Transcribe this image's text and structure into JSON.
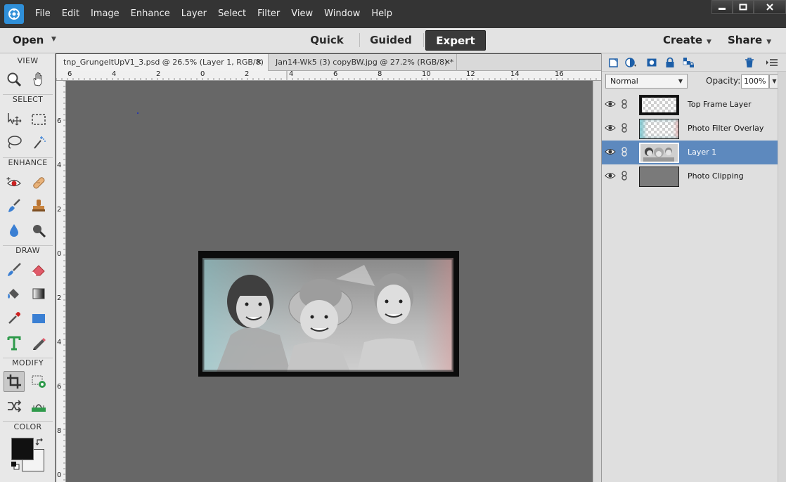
{
  "menu": [
    "File",
    "Edit",
    "Image",
    "Enhance",
    "Layer",
    "Select",
    "Filter",
    "View",
    "Window",
    "Help"
  ],
  "modebar": {
    "open_label": "Open",
    "tabs": [
      "Quick",
      "Guided",
      "Expert"
    ],
    "active_tab": "Expert",
    "create_label": "Create",
    "share_label": "Share"
  },
  "toolbox": {
    "sections": [
      "VIEW",
      "SELECT",
      "ENHANCE",
      "DRAW",
      "MODIFY",
      "COLOR"
    ],
    "foreground_color": "#111111",
    "background_color": "#f4f4f4"
  },
  "documents": [
    {
      "title": "tnp_GrungeItUpV1_3.psd @ 26.5% (Layer 1, RGB/8) *",
      "active": true
    },
    {
      "title": "Jan14-Wk5 (3) copyBW.jpg @ 27.2% (RGB/8) *",
      "active": false
    }
  ],
  "ruler": {
    "top_labels": [
      "6",
      "4",
      "2",
      "0",
      "2",
      "4",
      "6",
      "8",
      "10",
      "12",
      "14",
      "16"
    ],
    "left_labels": [
      "6",
      "4",
      "2",
      "0",
      "2",
      "4",
      "6",
      "8",
      "0"
    ]
  },
  "layers": {
    "blend_mode": "Normal",
    "opacity_label": "Opacity:",
    "opacity_value": "100%",
    "items": [
      {
        "name": "Top Frame Layer",
        "selected": false
      },
      {
        "name": "Photo Filter Overlay",
        "selected": false
      },
      {
        "name": "Layer 1",
        "selected": true
      },
      {
        "name": "Photo Clipping",
        "selected": false
      }
    ]
  },
  "colors": {
    "accent": "#2f8fd8",
    "selected_layer": "#5d89be",
    "canvas": "#676767"
  }
}
